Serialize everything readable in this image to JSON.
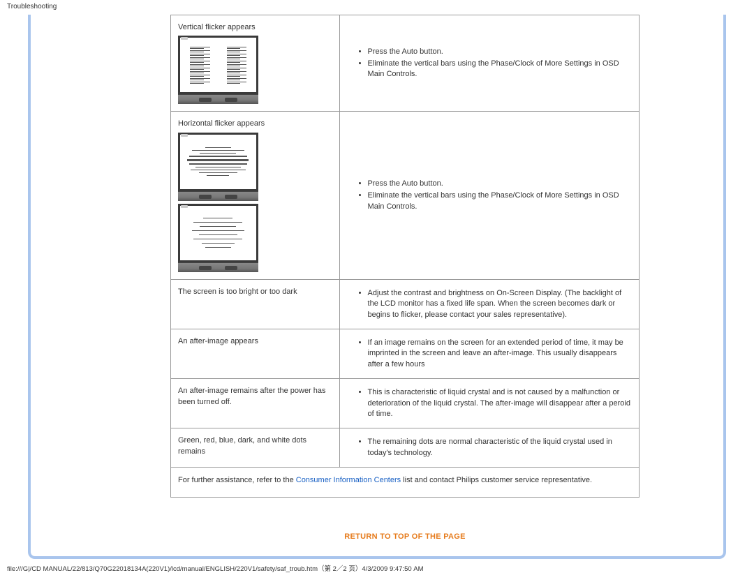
{
  "header": {
    "title": "Troubleshooting"
  },
  "rows": {
    "r1": {
      "problem": "Vertical flicker appears",
      "sol1": "Press the Auto button.",
      "sol2": "Eliminate the vertical bars using the Phase/Clock of More Settings in OSD Main Controls."
    },
    "r2": {
      "problem": "Horizontal flicker appears",
      "sol1": "Press the Auto button.",
      "sol2": "Eliminate the vertical bars using the Phase/Clock of More Settings in OSD Main Controls."
    },
    "r3": {
      "problem": "The screen is too bright or too dark",
      "sol1": "Adjust the contrast and brightness on On-Screen Display. (The backlight of the LCD monitor has a fixed life span. When the screen becomes dark or begins to flicker, please contact your sales representative)."
    },
    "r4": {
      "problem": "An after-image appears",
      "sol1": "If an image remains on the screen for an extended period of time, it may be imprinted in the screen and leave an after-image. This usually disappears after a few hours"
    },
    "r5": {
      "problem": "An after-image remains after the power has been turned off.",
      "sol1": "This is characteristic of liquid crystal and is not caused by a malfunction or deterioration of the liquid crystal. The after-image will disappear after a peroid of time."
    },
    "r6": {
      "problem": "Green, red, blue, dark, and white dots remains",
      "sol1": "The remaining dots are normal characteristic of the liquid crystal used in today's technology."
    }
  },
  "footer": {
    "prefix": "For further assistance, refer to the ",
    "link": "Consumer Information Centers",
    "suffix": " list and contact Philips customer service representative."
  },
  "return_link": "RETURN TO TOP OF THE PAGE",
  "path": "file:///G|/CD MANUAL/22/813/Q70G22018134A(220V1)/lcd/manual/ENGLISH/220V1/safety/saf_troub.htm（第 2／2 页）4/3/2009 9:47:50 AM"
}
